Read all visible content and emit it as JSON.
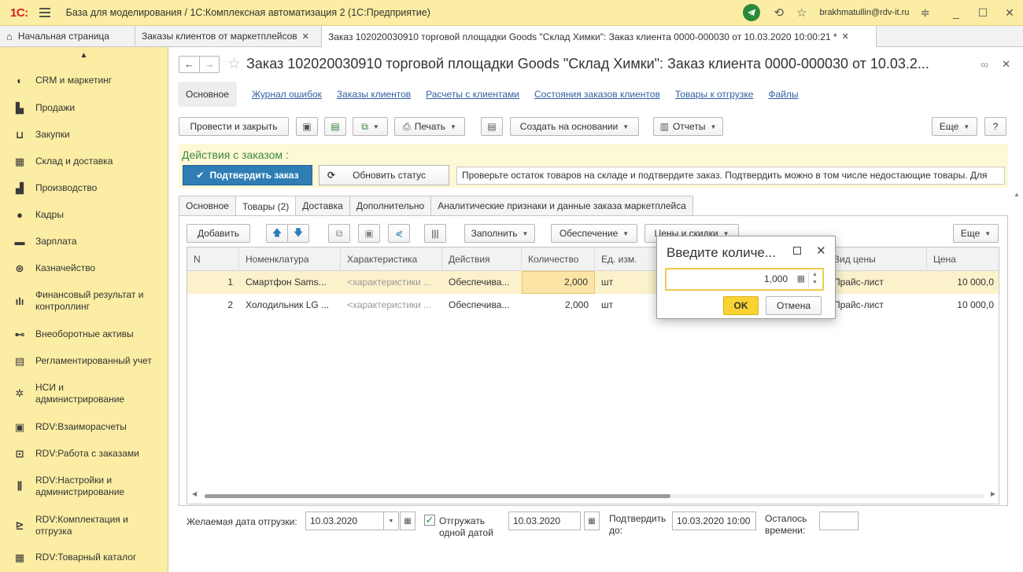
{
  "window": {
    "logo": "1С:",
    "title": "База для моделирования / 1С:Комплексная автоматизация 2  (1С:Предприятие)",
    "user": "brakhmatullin@rdv-it.ru"
  },
  "tabs": [
    {
      "label": "Начальная страница"
    },
    {
      "label": "Заказы клиентов от маркетплейсов"
    },
    {
      "label": "Заказ 102020030910 торговой площадки Goods \"Склад Химки\": Заказ клиента 0000-000030 от 10.03.2020 10:00:21 *"
    }
  ],
  "sidebar": {
    "items": [
      {
        "label": "CRM и маркетинг",
        "icon": "crm-icon"
      },
      {
        "label": "Продажи",
        "icon": "sales-icon"
      },
      {
        "label": "Закупки",
        "icon": "cart-icon"
      },
      {
        "label": "Склад и доставка",
        "icon": "warehouse-icon"
      },
      {
        "label": "Производство",
        "icon": "factory-icon"
      },
      {
        "label": "Кадры",
        "icon": "person-icon"
      },
      {
        "label": "Зарплата",
        "icon": "salary-icon"
      },
      {
        "label": "Казначейство",
        "icon": "treasury-icon"
      },
      {
        "label": "Финансовый результат и контроллинг",
        "icon": "chart-icon"
      },
      {
        "label": "Внеоборотные активы",
        "icon": "car-icon"
      },
      {
        "label": "Регламентированный учет",
        "icon": "ledger-icon"
      },
      {
        "label": "НСИ и администрирование",
        "icon": "gear-icon"
      },
      {
        "label": "RDV:Взаиморасчеты",
        "icon": "calculator-icon"
      },
      {
        "label": "RDV:Работа с заказами",
        "icon": "orders-icon"
      },
      {
        "label": "RDV:Настройки и администрирование",
        "icon": "settings-icon"
      },
      {
        "label": "RDV:Комплектация и отгрузка",
        "icon": "shipping-icon"
      },
      {
        "label": "RDV:Товарный каталог",
        "icon": "catalog-icon"
      }
    ]
  },
  "document": {
    "title": "Заказ 102020030910 торговой площадки Goods \"Склад Химки\": Заказ клиента 0000-000030 от 10.03.2...",
    "sections": {
      "active": "Основное",
      "links": [
        "Журнал ошибок",
        "Заказы клиентов",
        "Расчеты с клиентами",
        "Состояния заказов клиентов",
        "Товары к отгрузке",
        "Файлы"
      ]
    },
    "toolbar": {
      "post_close": "Провести и закрыть",
      "print": "Печать",
      "create_based": "Создать на основании",
      "reports": "Отчеты",
      "more": "Еще",
      "help": "?"
    },
    "actions": {
      "title": "Действия с заказом :",
      "confirm": "Подтвердить заказ",
      "refresh": "Обновить статус",
      "hint": "Проверьте остаток товаров на складе и подтвердите заказ. Подтвердить можно в том числе недостающие товары. Для"
    },
    "page_tabs": [
      "Основное",
      "Товары (2)",
      "Доставка",
      "Дополнительно",
      "Аналитические признаки и данные заказа маркетплейса"
    ],
    "goods_toolbar": {
      "add": "Добавить",
      "fill": "Заполнить",
      "supply": "Обеспечение",
      "prices": "Цены и скидки",
      "more": "Еще"
    },
    "table": {
      "columns": [
        "N",
        "Номенклатура",
        "Характеристика",
        "Действия",
        "Количество",
        "Ед. изм.",
        "Вид цены",
        "Цена"
      ],
      "rows": [
        {
          "n": "1",
          "item": "Смартфон Sams...",
          "char": "<характеристики ...",
          "action": "Обеспечива...",
          "qty": "2,000",
          "unit": "шт",
          "price_type": "Прайс-лист",
          "price": "10 000,0"
        },
        {
          "n": "2",
          "item": "Холодильник LG ...",
          "char": "<характеристики ...",
          "action": "Обеспечива...",
          "qty": "2,000",
          "unit": "шт",
          "price_type": "Прайс-лист",
          "price": "10 000,0"
        }
      ]
    },
    "footer": {
      "ship_date_label": "Желаемая дата отгрузки:",
      "ship_date": "10.03.2020",
      "ship_one_date": "Отгружать одной датой",
      "ship_one_date_value": "10.03.2020",
      "confirm_by_label": "Подтвердить до:",
      "confirm_by": "10.03.2020 10:00",
      "time_left_label": "Осталось времени:"
    }
  },
  "dialog": {
    "title": "Введите количе...",
    "value": "1,000",
    "ok": "OK",
    "cancel": "Отмена"
  },
  "colors": {
    "sidebar_bg": "#fbeda3",
    "accent_blue": "#2e7db5",
    "link": "#2f5fa4",
    "ok_button": "#f8d331",
    "actions_title": "#3d8a3d"
  }
}
